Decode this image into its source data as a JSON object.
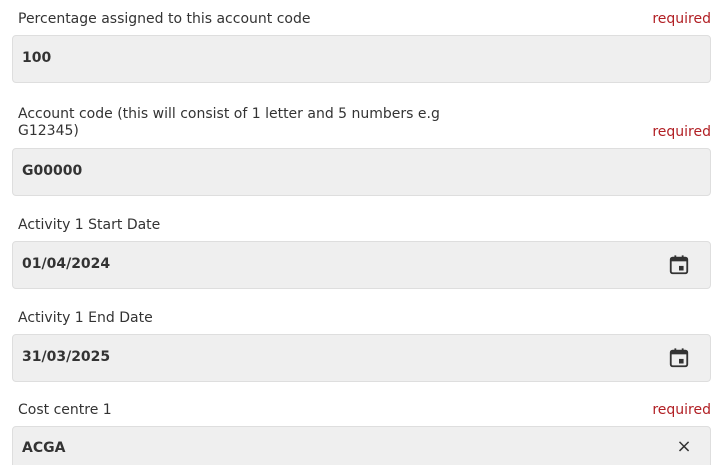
{
  "fields": [
    {
      "label": "Percentage assigned to this account code",
      "required_text": "required",
      "value": "100"
    },
    {
      "label_line1": "Account code (this will consist of 1 letter and 5 numbers e.g",
      "label_line2": "G12345)",
      "required_text": "required",
      "value": "G00000"
    },
    {
      "label": "Activity 1 Start Date",
      "value": "01/04/2024",
      "icon": "calendar-icon"
    },
    {
      "label": "Activity 1 End Date",
      "value": "31/03/2025",
      "icon": "calendar-icon"
    },
    {
      "label": "Cost centre 1",
      "required_text": "required",
      "value": "ACGA",
      "clear_symbol": "×"
    }
  ]
}
